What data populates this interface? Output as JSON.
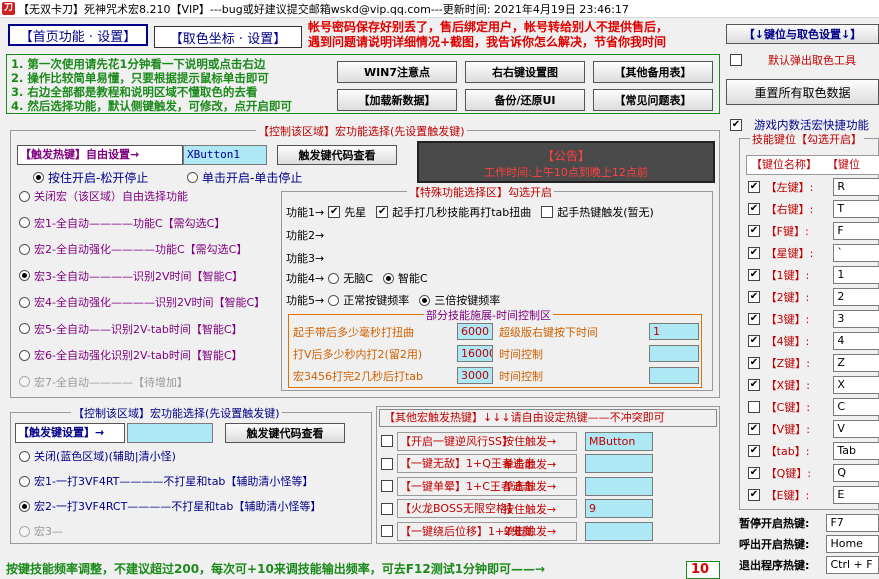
{
  "window": {
    "title": "【无双卡刀】死神咒术宏8.210【VIP】---bug或好建议提交邮箱wskd@vip.qq.com---更新时间: 2021年4月19日 23:46:17",
    "icon": "app-icon"
  },
  "tabs": {
    "home": "【首页功能 · 设置】",
    "color": "【取色坐标 · 设置】"
  },
  "notice_top": {
    "line1": "帐号密码保存好别丢了，售后绑定用户，帐号转给别人不提供售后，",
    "line2": "遇到问题请说明详细情况+截图，我告诉你怎么解决，节省你我时间"
  },
  "instructions": [
    "1. 第一次使用请先花1分钟看一下说明或点击右边",
    "2. 操作比较简单易懂，只要根据提示鼠标单击即可",
    "3. 右边全部都是教程和说明区域不懂取色的去看",
    "4. 然后选择功能，默认侧键触发，可修改，点开启即可"
  ],
  "help_buttons": [
    "WIN7注意点",
    "右右键设置图",
    "【其他备用表】",
    "【加载新数据】",
    "备份/还原UI",
    "【常见问题表】"
  ],
  "right_panel": {
    "keybind_dropdown": "【↓键位与取色设置↓】",
    "popup_check": "默认弹出取色工具",
    "reset_button": "重置所有取色数据",
    "ingame_check": "游戏内数活宏快捷功能",
    "skill_header": "技能键位【勾选开启】",
    "col_name": "【键位名称】",
    "col_key": "【键位"
  },
  "key_rows": [
    {
      "name": "【左键】:",
      "key": "R",
      "checked": true
    },
    {
      "name": "【右键】:",
      "key": "T",
      "checked": true
    },
    {
      "name": "【F键】:",
      "key": "F",
      "checked": true
    },
    {
      "name": "【星键】:",
      "key": "`",
      "checked": true
    },
    {
      "name": "【1键】:",
      "key": "1",
      "checked": true
    },
    {
      "name": "【2键】:",
      "key": "2",
      "checked": true
    },
    {
      "name": "【3键】:",
      "key": "3",
      "checked": true
    },
    {
      "name": "【4键】:",
      "key": "4",
      "checked": true
    },
    {
      "name": "【Z键】:",
      "key": "Z",
      "checked": true
    },
    {
      "name": "【X键】:",
      "key": "X",
      "checked": true
    },
    {
      "name": "【C键】:",
      "key": "C",
      "checked": false
    },
    {
      "name": "【V键】:",
      "key": "V",
      "checked": true
    },
    {
      "name": "【tab】:",
      "key": "Tab",
      "checked": true
    },
    {
      "name": "【Q键】:",
      "key": "Q",
      "checked": true
    },
    {
      "name": "【E键】:",
      "key": "E",
      "checked": true
    }
  ],
  "hotkeys": [
    {
      "label": "暂停开启热键:",
      "value": "F7"
    },
    {
      "label": "呼出开启热键:",
      "value": "Home"
    },
    {
      "label": "退出程序热键:",
      "value": "Ctrl + F"
    }
  ],
  "control_area": {
    "title": "【控制该区域】宏功能选择(先设置触发键)",
    "trigger_label": "【触发热键】自由设置→",
    "trigger_value": "XButton1",
    "trigger_btn": "触发键代码查看",
    "mode_hold": "按住开启-松开停止",
    "mode_click": "单击开启-单击停止",
    "announce_title": "【公告】",
    "announce_text": "工作时间:上午10点到晚上12点前",
    "macros": [
      "关闭宏（该区域）自由选择功能",
      "宏1-全自动————功能C【需勾选C】",
      "宏2-全自动强化————功能C【需勾选C】",
      "宏3-全自动————识别2V时间【智能C】",
      "宏4-全自动强化————识别2V时间【智能C】",
      "宏5-全自动——识别2V-tab时间【智能C】",
      "宏6-全自动强化识别2V-tab时间【智能C】",
      "宏7-全自动————【待增加】"
    ],
    "special_title": "【特殊功能选择区】勾选开启",
    "f1": "功能1→",
    "f1a": "先星",
    "f1b": "起手打几秒技能再打tab扭曲",
    "f1c": "起手热键触发(暂无)",
    "f2": "功能2→",
    "f3": "功能3→",
    "f4": "功能4→",
    "f4a": "无脑C",
    "f4b": "智能C",
    "f5": "功能5→",
    "f5a": "正常按键频率",
    "f5b": "三倍按键频率",
    "timing_title": "部分技能施展-时间控制区",
    "t1": "起手带后多少毫秒打扭曲",
    "t1v": "6000",
    "t2": "超级版右键按下时间",
    "t2v": "1",
    "t3": "打V后多少秒内打2(留2用)",
    "t3v": "16000",
    "t4": "时间控制",
    "t4v": "",
    "t5": "宏3456打完2几秒后打tab",
    "t5v": "3000",
    "t6": "时间控制",
    "t6v": ""
  },
  "control_area2": {
    "title": "【控制该区域】宏功能选择(先设置触发键)",
    "trigger_label": "【触发键设置】→",
    "trigger_value": "",
    "trigger_btn": "触发键代码查看",
    "macros": [
      "关闭(蓝色区域)(辅助|清小怪)",
      "宏1-一打3VF4RT————不打星和tab【辅助清小怪等】",
      "宏2-一打3VF4RCT————不打星和tab【辅助清小怪等】",
      "宏3—"
    ]
  },
  "other_hotkeys": {
    "title": "【其他宏触发热键】↓↓↓请自由设定热键——不冲突即可",
    "rows": [
      {
        "label": "【开启一键逆风行SS】",
        "mode": "按住触发→",
        "value": "MButton"
      },
      {
        "label": "【一键无敌】1+Q王者追击",
        "mode": "单击触发→",
        "value": ""
      },
      {
        "label": "【一键单晕】1+C王者追击",
        "mode": "单击触发→",
        "value": ""
      },
      {
        "label": "【火龙BOSS无限空格】",
        "mode": "按住触发→",
        "value": "9"
      },
      {
        "label": "【一键绕后位移】1+2鬼弑",
        "mode": "单击触发→",
        "value": ""
      }
    ]
  },
  "bottom": {
    "text": "按键技能频率调整，不建议超过200，每次可+10来调技能输出频率，可去F12测试1分钟即可——→",
    "value": "10"
  },
  "colors": {
    "red": "#e00000",
    "navy": "#00008b",
    "green": "#1a8a1a",
    "purple": "#800080",
    "announce_bg": "#4a4a4a"
  }
}
